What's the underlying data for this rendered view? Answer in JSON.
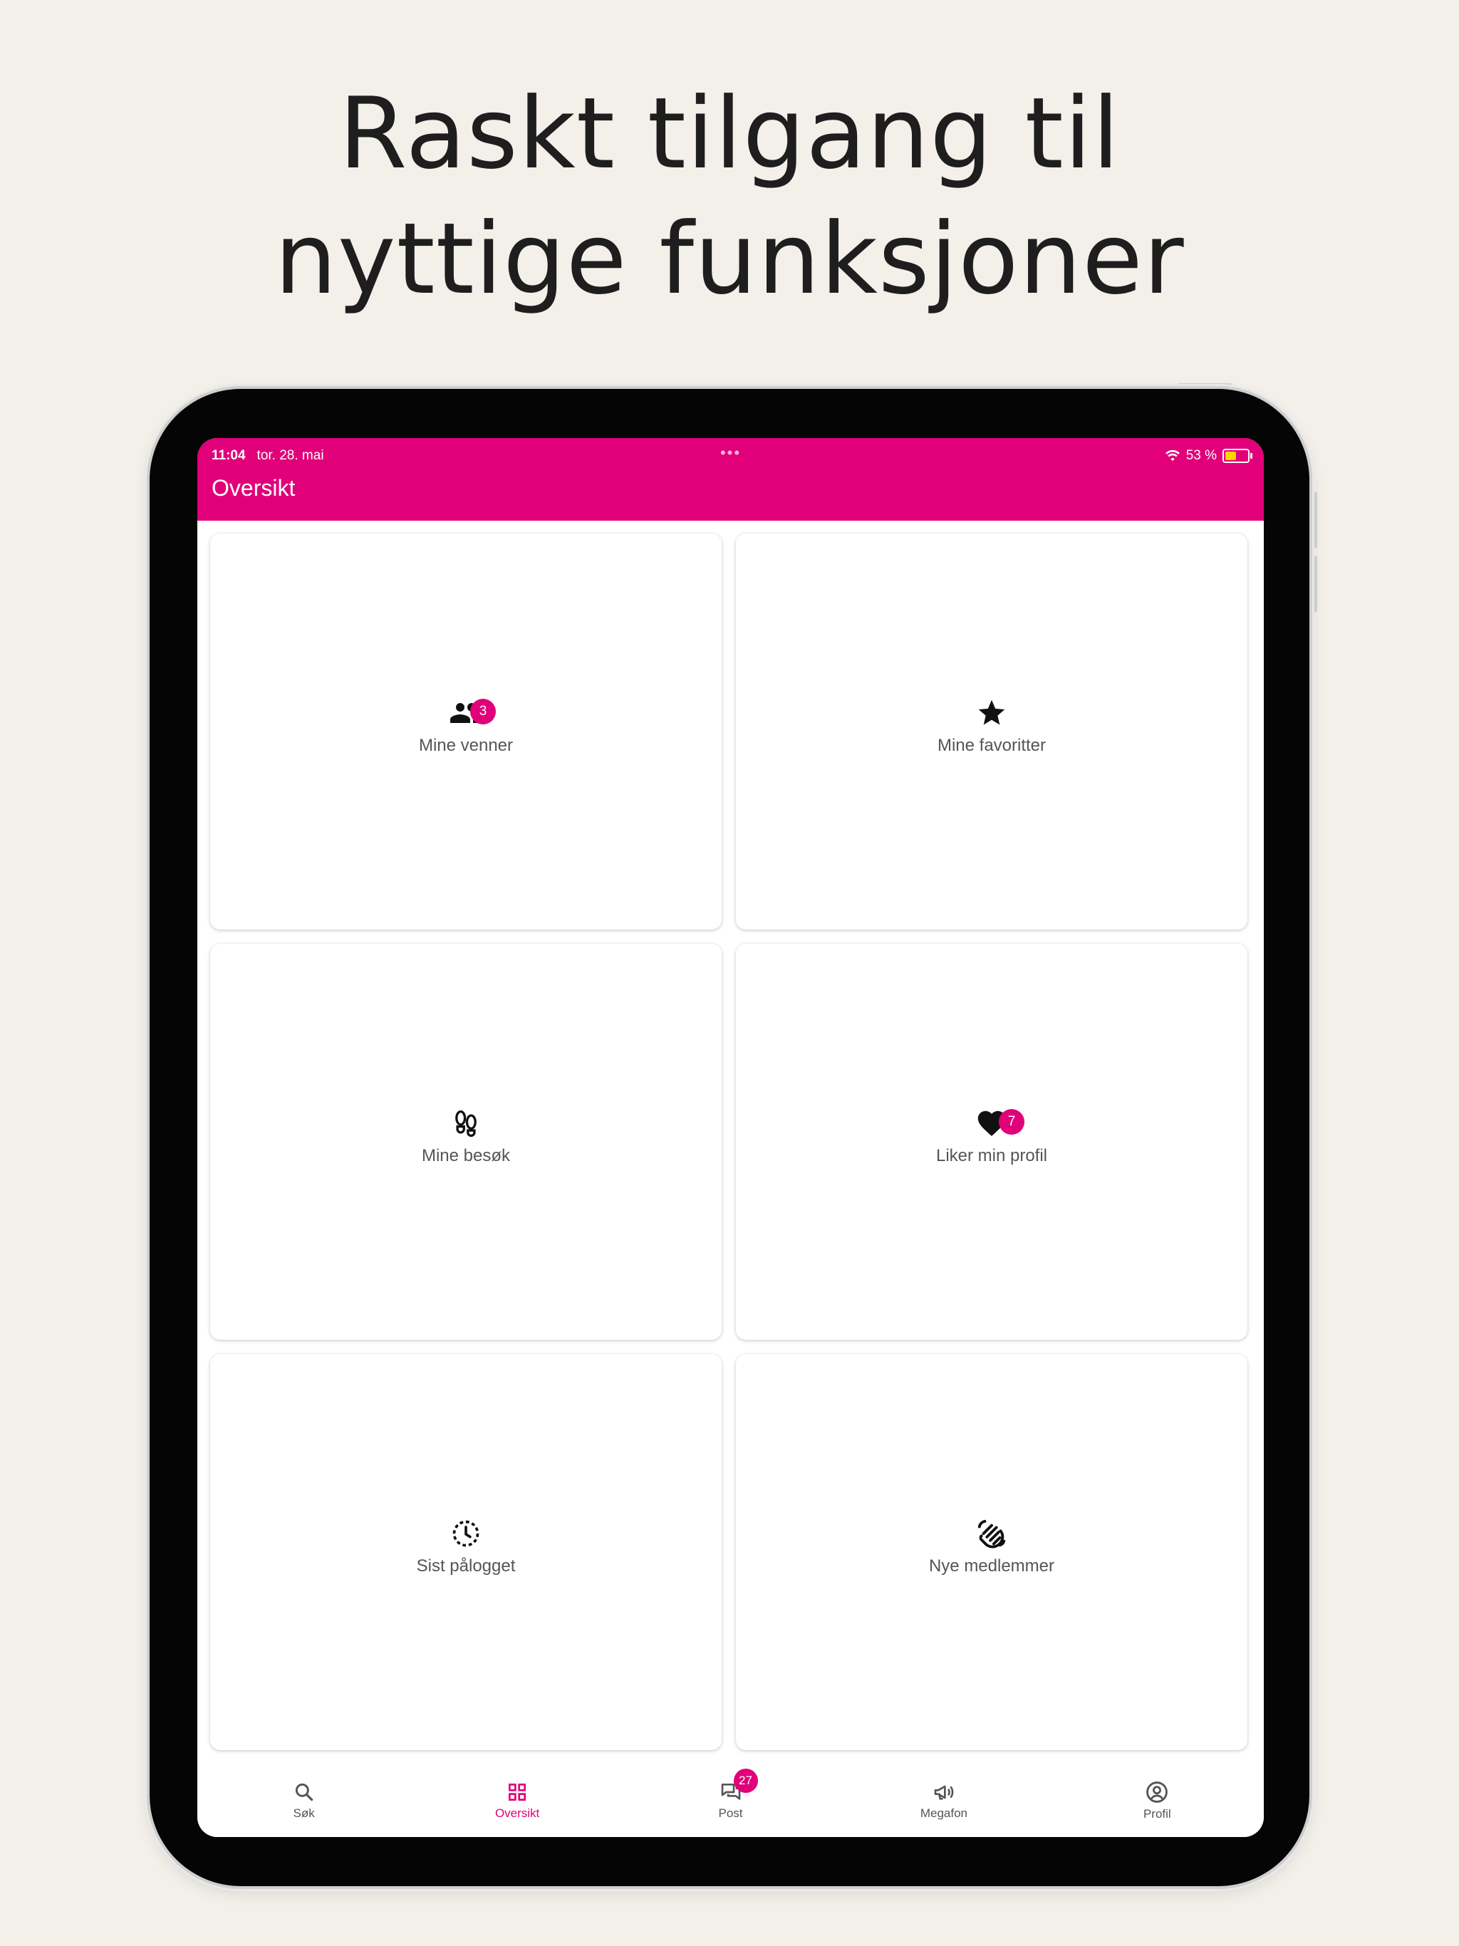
{
  "headline": {
    "line1": "Raskt tilgang til",
    "line2": "nyttige funksjoner"
  },
  "status_bar": {
    "time": "11:04",
    "date": "tor. 28. mai",
    "battery": "53 %",
    "battery_level": 0.53
  },
  "app_bar": {
    "title": "Oversikt"
  },
  "colors": {
    "accent": "#e2007a",
    "background": "#f3efe9"
  },
  "cards": [
    {
      "label": "Mine venner",
      "icon": "people-icon",
      "badge": "3"
    },
    {
      "label": "Mine favoritter",
      "icon": "star-icon"
    },
    {
      "label": "Mine besøk",
      "icon": "footprints-icon"
    },
    {
      "label": "Liker min profil",
      "icon": "heart-icon",
      "badge": "7"
    },
    {
      "label": "Sist pålogget",
      "icon": "clock-icon"
    },
    {
      "label": "Nye medlemmer",
      "icon": "waving-hand-icon"
    }
  ],
  "bottom_nav": [
    {
      "label": "Søk",
      "icon": "search-icon"
    },
    {
      "label": "Oversikt",
      "icon": "grid-icon",
      "active": true
    },
    {
      "label": "Post",
      "icon": "chat-icon",
      "badge": "27"
    },
    {
      "label": "Megafon",
      "icon": "megaphone-icon"
    },
    {
      "label": "Profil",
      "icon": "profile-icon"
    }
  ]
}
